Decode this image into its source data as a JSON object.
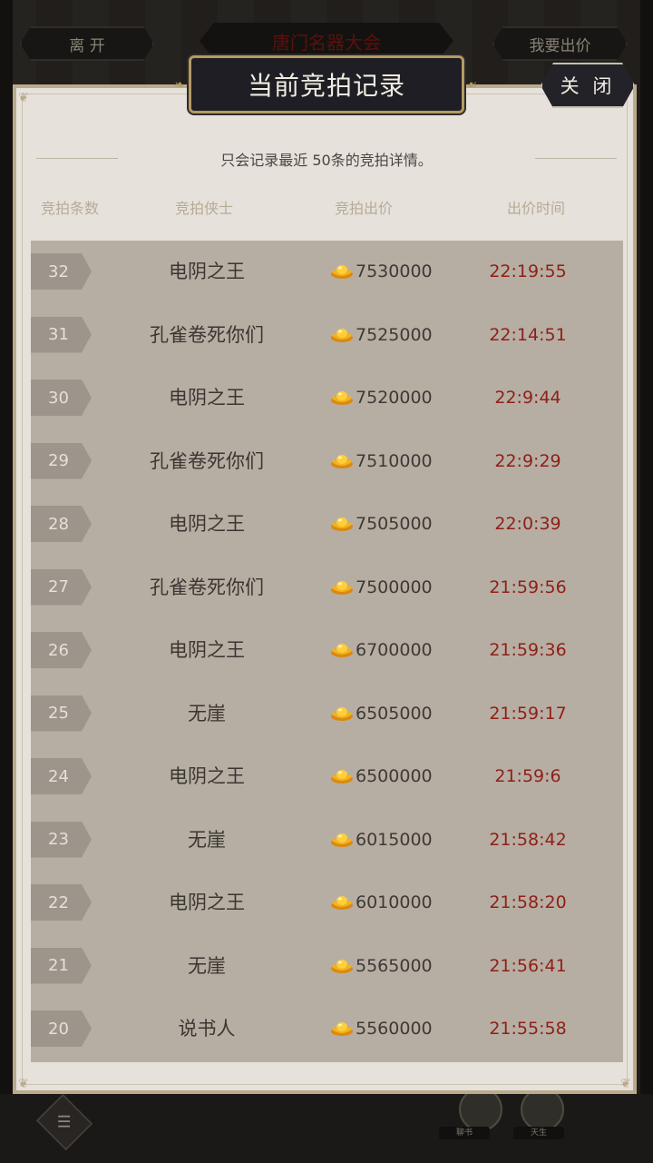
{
  "background": {
    "leave_button": "离 开",
    "event_title": "唐门名器大会",
    "bid_button": "我要出价",
    "avatar_labels": [
      "聊书",
      "天生"
    ]
  },
  "dialog": {
    "title": "当前竞拍记录",
    "close_label": "关 闭",
    "notice": "只会记录最近 50条的竞拍详情。",
    "columns": [
      "竞拍条数",
      "竞拍侠士",
      "竞拍出价",
      "出价时间"
    ],
    "rows": [
      {
        "num": "32",
        "name": "电阴之王",
        "price": "7530000",
        "time": "22:19:55"
      },
      {
        "num": "31",
        "name": "孔雀卷死你们",
        "price": "7525000",
        "time": "22:14:51"
      },
      {
        "num": "30",
        "name": "电阴之王",
        "price": "7520000",
        "time": "22:9:44"
      },
      {
        "num": "29",
        "name": "孔雀卷死你们",
        "price": "7510000",
        "time": "22:9:29"
      },
      {
        "num": "28",
        "name": "电阴之王",
        "price": "7505000",
        "time": "22:0:39"
      },
      {
        "num": "27",
        "name": "孔雀卷死你们",
        "price": "7500000",
        "time": "21:59:56"
      },
      {
        "num": "26",
        "name": "电阴之王",
        "price": "6700000",
        "time": "21:59:36"
      },
      {
        "num": "25",
        "name": "无崖",
        "price": "6505000",
        "time": "21:59:17"
      },
      {
        "num": "24",
        "name": "电阴之王",
        "price": "6500000",
        "time": "21:59:6"
      },
      {
        "num": "23",
        "name": "无崖",
        "price": "6015000",
        "time": "21:58:42"
      },
      {
        "num": "22",
        "name": "电阴之王",
        "price": "6010000",
        "time": "21:58:20"
      },
      {
        "num": "21",
        "name": "无崖",
        "price": "5565000",
        "time": "21:56:41"
      },
      {
        "num": "20",
        "name": "说书人",
        "price": "5560000",
        "time": "21:55:58"
      }
    ]
  },
  "colors": {
    "time_text": "#8f1f17",
    "tag_bg": "#9d948b",
    "list_bg": "#b7aea3",
    "panel_bg": "#e6e1db",
    "title_plate": "#1f1e24"
  },
  "icons": {
    "currency": "gold-ingot-icon",
    "chat": "chat-icon"
  }
}
